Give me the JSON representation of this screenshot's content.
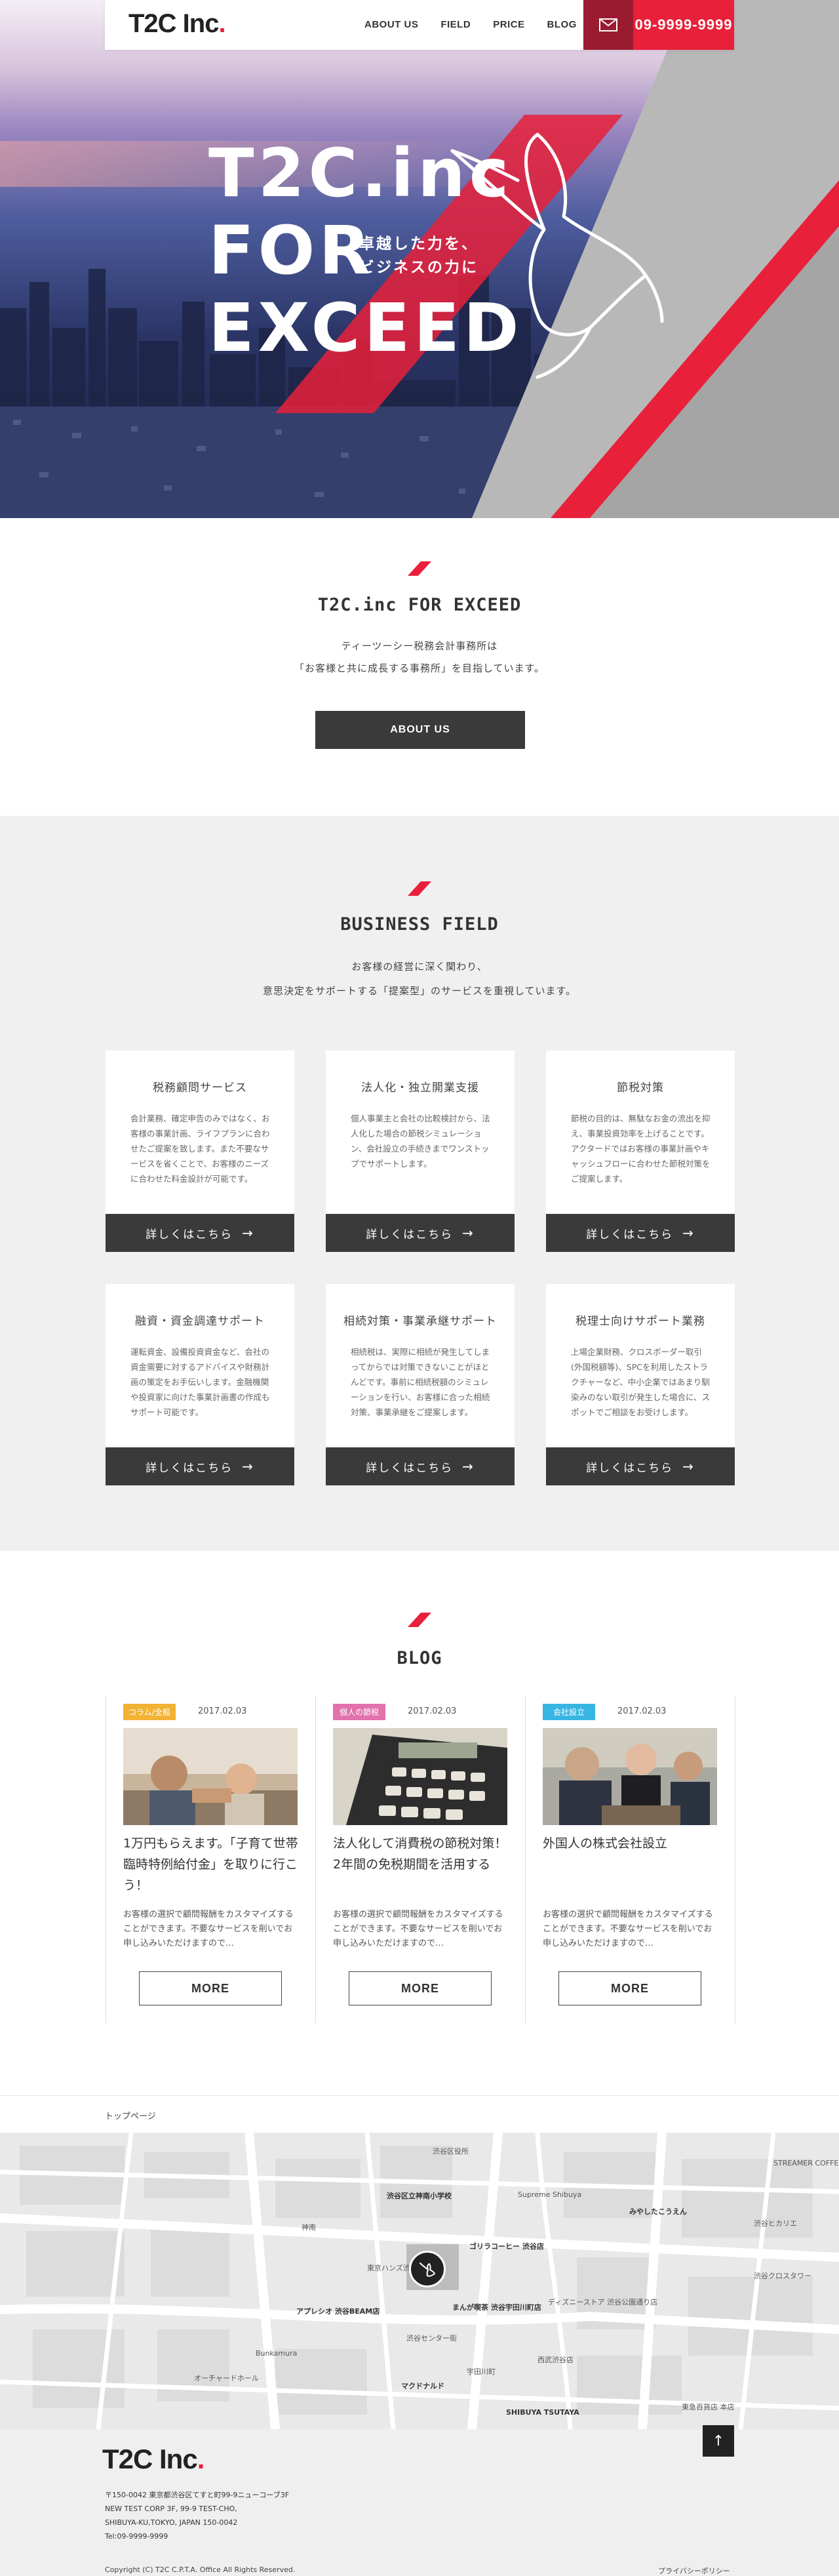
{
  "header": {
    "logo": "T2C Inc",
    "logo_dot": ".",
    "nav": [
      "ABOUT US",
      "FIELD",
      "PRICE",
      "BLOG"
    ],
    "tel": "09-9999-9999"
  },
  "hero": {
    "title_lines": [
      "T2C.inc",
      "FOR",
      "EXCEED"
    ],
    "sub_lines": [
      "卓越した力を、",
      "ビジネスの力に"
    ]
  },
  "about": {
    "title": "T2C.inc FOR EXCEED",
    "lines": [
      "ティーツーシー税務会計事務所は",
      "「お客様と共に成長する事務所」を目指しています。"
    ],
    "button": "ABOUT US"
  },
  "business": {
    "title": "BUSINESS FIELD",
    "lines": [
      "お客様の経営に深く関わり、",
      "意思決定をサポートする「提案型」のサービスを重視しています。"
    ],
    "more_label": "詳しくはこちら",
    "cards": [
      {
        "title": "税務顧問サービス",
        "body": "会計業務、確定申告のみではなく、お客様の事業計画、ライフプランに合わせたご提案を致します。また不要なサービスを省くことで、お客様のニーズに合わせた料金設計が可能です。"
      },
      {
        "title": "法人化・独立開業支援",
        "body": "個人事業主と会社の比較検討から、法人化した場合の節税シミュレーション、会社設立の手続きまでワンストップでサポートします。"
      },
      {
        "title": "節税対策",
        "body": "節税の目的は、無駄なお金の流出を抑え、事業投資効率を上げることです。アクタードではお客様の事業計画やキャッシュフローに合わせた節税対策をご提案します。"
      },
      {
        "title": "融資・資金調達サポート",
        "body": "運転資金、設備投資資金など、会社の資金需要に対するアドバイスや財務計画の策定をお手伝いします。金融機関や投資家に向けた事業計画書の作成もサポート可能です。"
      },
      {
        "title": "相続対策・事業承継サポート",
        "body": "相続税は、実際に相続が発生してしまってからでは対策できないことがほとんどです。事前に相続税額のシミュレーションを行い、お客様に合った相続対策、事業承継をご提案します。"
      },
      {
        "title": "税理士向けサポート業務",
        "body": "上場企業財務、クロスボーダー取引(外国税額等)、SPCを利用したストラクチャーなど、中小企業ではあまり馴染みのない取引が発生した場合に、スポットでご相談をお受けします。"
      }
    ]
  },
  "blog": {
    "title": "BLOG",
    "more": "MORE",
    "posts": [
      {
        "tag": "コラム/全般",
        "tag_color": "#f2b233",
        "date": "2017.02.03",
        "title": "1万円もらえます。「子育て世帯臨時特例給付金」を取りに行こう！",
        "excerpt": "お客様の選択で顧問報酬をカスタマイズすることができます。不要なサービスを削いでお申し込みいただけますので…"
      },
      {
        "tag": "個人の節税",
        "tag_color": "#e271ac",
        "date": "2017.02.03",
        "title": "法人化して消費税の節税対策！2年間の免税期間を活用する",
        "excerpt": "お客様の選択で顧問報酬をカスタマイズすることができます。不要なサービスを削いでお申し込みいただけますので…"
      },
      {
        "tag": "会社設立",
        "tag_color": "#38b6e3",
        "date": "2017.02.03",
        "title": "外国人の株式会社設立",
        "excerpt": "お客様の選択で顧問報酬をカスタマイズすることができます。不要なサービスを削いでお申し込みいただけますので…"
      }
    ]
  },
  "breadcrumb": "トップページ",
  "map": {
    "labels": [
      "渋谷区立神南小学校",
      "Supreme Shibuya",
      "東京ハンズ渋谷店",
      "アプレシオ 渋谷BEAM店",
      "渋谷センター街",
      "ゴリラコーヒー 渋谷店",
      "まんが喫茶 渋谷宇田川町店",
      "ディズニーストア 渋谷公園通り店",
      "西武渋谷店",
      "宇田川町",
      "SHIBUYA TSUTAYA",
      "マクドナルド",
      "Bunkamura",
      "オーチャードホール",
      "神南",
      "渋谷区役所",
      "みやしたこうえん",
      "渋谷ヒカリエ",
      "東急百貨店 本店",
      "STREAMER COFFEE COMPANY",
      "渋谷クロスタワー"
    ]
  },
  "footer": {
    "logo": "T2C Inc",
    "address_lines": [
      "〒150-0042 東京都渋谷区てすと町99-9ニューコーブ3F",
      "NEW TEST CORP 3F, 99-9 TEST-CHO,",
      "SHIBUYA-KU,TOKYO, JAPAN 150-0042",
      "Tel:09-9999-9999"
    ],
    "copyright": "Copyright (C) T2C C.P.T.A. Office All Rights Reserved.",
    "policy": "プライバシーポリシー"
  },
  "colors": {
    "accent": "#e8203a",
    "dark": "#3a3a3a",
    "gray_bg": "#f0f0f0"
  }
}
